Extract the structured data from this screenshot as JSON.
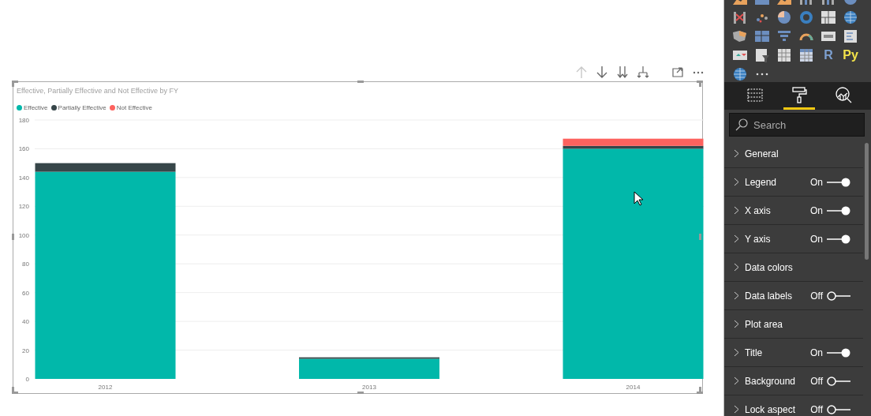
{
  "visual": {
    "title": "Effective, Partially Effective and Not Effective by FY",
    "chart_data": {
      "type": "bar",
      "stacked": true,
      "orientation": "vertical",
      "grid": true,
      "categories": [
        "2012",
        "2013",
        "2014"
      ],
      "series": [
        {
          "name": "Effective",
          "color": "#01b8aa",
          "values": [
            144,
            14,
            160
          ]
        },
        {
          "name": "Partially Effective",
          "color": "#374649",
          "values": [
            6,
            1,
            2
          ]
        },
        {
          "name": "Not Effective",
          "color": "#fd625e",
          "values": [
            0,
            0,
            5
          ]
        }
      ],
      "ylim": [
        0,
        180
      ],
      "yticks": [
        0,
        20,
        40,
        60,
        80,
        100,
        120,
        140,
        160,
        180
      ]
    }
  },
  "visual_toolbar": [
    {
      "kind": "up",
      "disabled": true
    },
    {
      "kind": "down",
      "disabled": false
    },
    {
      "kind": "expand",
      "disabled": false
    },
    {
      "kind": "fork",
      "disabled": false
    },
    {
      "kind": "focus",
      "disabled": false
    },
    {
      "kind": "more",
      "disabled": false
    }
  ],
  "gallery": [
    {
      "kind": "area"
    },
    {
      "kind": "stacked-area"
    },
    {
      "kind": "area"
    },
    {
      "kind": "combo"
    },
    {
      "kind": "combo"
    },
    {
      "kind": "map"
    },
    {
      "kind": "ribbon"
    },
    {
      "kind": "scatter"
    },
    {
      "kind": "pie"
    },
    {
      "kind": "donut"
    },
    {
      "kind": "treemap"
    },
    {
      "kind": "globe"
    },
    {
      "kind": "filled-map"
    },
    {
      "kind": "shape-map"
    },
    {
      "kind": "funnel"
    },
    {
      "kind": "gauge"
    },
    {
      "kind": "card"
    },
    {
      "kind": "multi-card"
    },
    {
      "kind": "kpi"
    },
    {
      "kind": "slicer"
    },
    {
      "kind": "table"
    },
    {
      "kind": "matrix"
    },
    {
      "kind": "text",
      "text": "R"
    },
    {
      "kind": "text",
      "text": "Py"
    },
    {
      "kind": "globe"
    },
    {
      "kind": "more"
    }
  ],
  "panel_tabs": [
    {
      "kind": "fields",
      "selected": false
    },
    {
      "kind": "format",
      "selected": true
    },
    {
      "kind": "analytics",
      "selected": false
    }
  ],
  "search": {
    "placeholder": "Search"
  },
  "sections": [
    {
      "label": "General"
    },
    {
      "label": "Legend",
      "toggle": {
        "text": "On",
        "on": true
      }
    },
    {
      "label": "X axis",
      "toggle": {
        "text": "On",
        "on": true
      }
    },
    {
      "label": "Y axis",
      "toggle": {
        "text": "On",
        "on": true
      }
    },
    {
      "label": "Data colors"
    },
    {
      "label": "Data labels",
      "toggle": {
        "text": "Off",
        "on": false
      }
    },
    {
      "label": "Plot area"
    },
    {
      "label": "Title",
      "toggle": {
        "text": "On",
        "on": true
      }
    },
    {
      "label": "Background",
      "toggle": {
        "text": "Off",
        "on": false
      }
    },
    {
      "label": "Lock aspect",
      "toggle": {
        "text": "Off",
        "on": false
      }
    }
  ]
}
